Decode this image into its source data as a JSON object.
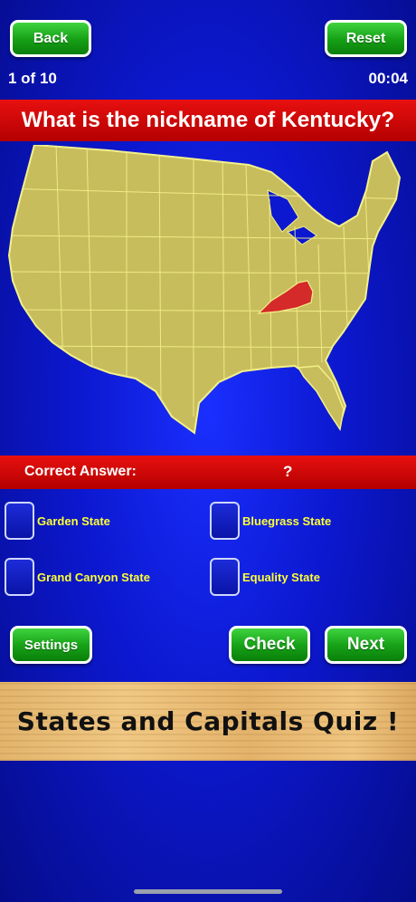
{
  "header": {
    "back_label": "Back",
    "reset_label": "Reset",
    "progress": "1 of 10",
    "timer": "00:04"
  },
  "question": "What is the nickname of Kentucky?",
  "answer_bar": {
    "label": "Correct Answer:",
    "value": "?"
  },
  "options": [
    {
      "label": "Garden State"
    },
    {
      "label": "Bluegrass State"
    },
    {
      "label": "Grand Canyon State"
    },
    {
      "label": "Equality State"
    }
  ],
  "footer": {
    "settings_label": "Settings",
    "check_label": "Check",
    "next_label": "Next"
  },
  "banner": {
    "title": "States and Capitals Quiz !"
  },
  "map": {
    "highlighted_state": "Kentucky",
    "land_color": "#c8bd5c",
    "highlight_color": "#d42a2a",
    "border_color": "#f3f08a"
  }
}
